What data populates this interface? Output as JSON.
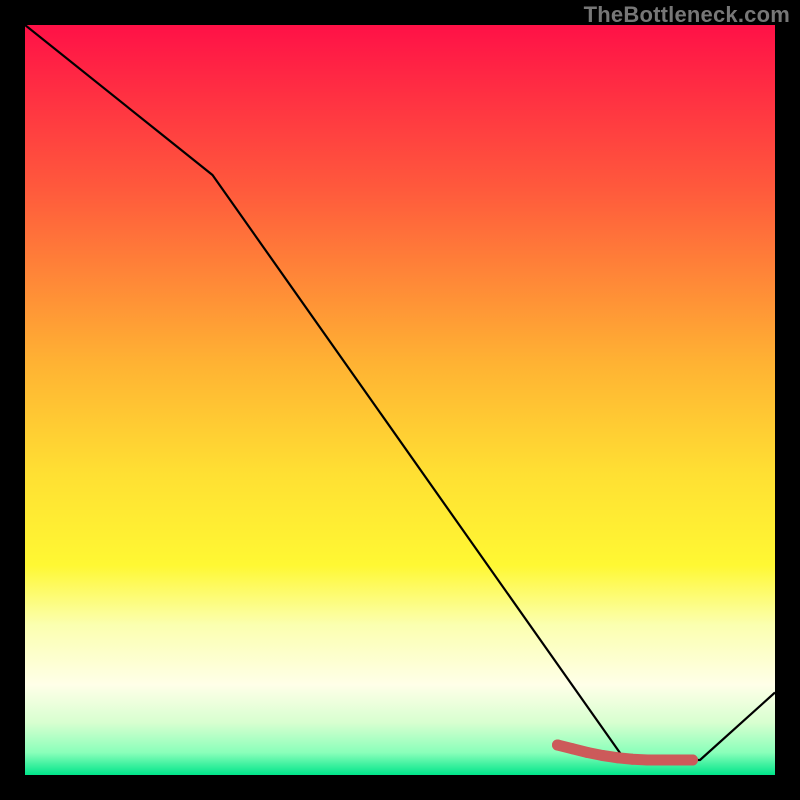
{
  "watermark": "TheBottleneck.com",
  "chart_data": {
    "type": "line",
    "title": "",
    "xlabel": "",
    "ylabel": "",
    "xlim": [
      0,
      100
    ],
    "ylim": [
      0,
      100
    ],
    "gradient_stops": [
      {
        "offset": 0,
        "color": "#ff1147"
      },
      {
        "offset": 0.22,
        "color": "#ff5a3c"
      },
      {
        "offset": 0.45,
        "color": "#ffb233"
      },
      {
        "offset": 0.6,
        "color": "#ffe033"
      },
      {
        "offset": 0.72,
        "color": "#fff833"
      },
      {
        "offset": 0.8,
        "color": "#fbffb0"
      },
      {
        "offset": 0.88,
        "color": "#ffffe8"
      },
      {
        "offset": 0.93,
        "color": "#d8ffd0"
      },
      {
        "offset": 0.97,
        "color": "#8affba"
      },
      {
        "offset": 1.0,
        "color": "#00e58a"
      }
    ],
    "series": [
      {
        "name": "bottleneck-curve",
        "color": "#000000",
        "x": [
          0,
          25,
          80,
          90,
          100
        ],
        "values": [
          100,
          80,
          2,
          2,
          11
        ]
      }
    ],
    "markers": {
      "name": "highlight-segment",
      "color": "#cc5a5a",
      "x": [
        71,
        73,
        75,
        77,
        79,
        81,
        83,
        85,
        87,
        89
      ],
      "values": [
        4,
        3.5,
        3.0,
        2.6,
        2.3,
        2.1,
        2.0,
        2.0,
        2.0,
        2.0
      ]
    }
  }
}
